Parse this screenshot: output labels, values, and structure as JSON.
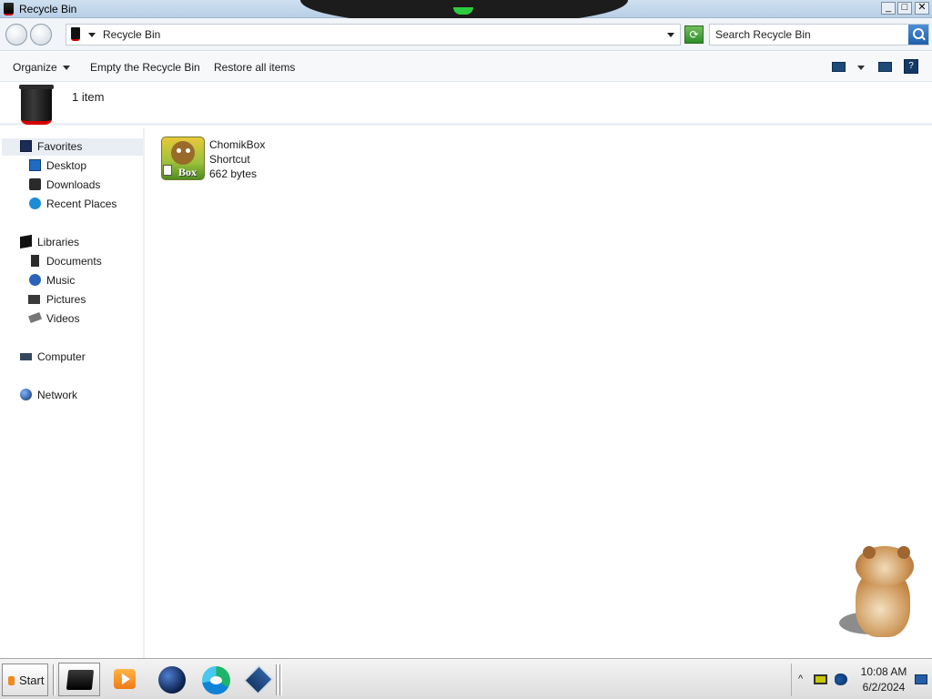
{
  "window": {
    "title": "Recycle Bin",
    "controls": {
      "minimize": "_",
      "maximize": "□",
      "close": "✕"
    }
  },
  "address": {
    "breadcrumb": "Recycle Bin",
    "search_placeholder": "Search Recycle Bin"
  },
  "toolbar": {
    "organize_label": "Organize",
    "empty_label": "Empty the Recycle Bin",
    "restore_label": "Restore all items",
    "help_label": "?"
  },
  "details": {
    "count": "1 item"
  },
  "sidebar": {
    "groups": [
      {
        "label": "Favorites",
        "icon": "star-icon",
        "items": [
          {
            "label": "Desktop",
            "icon": "desktop-icon"
          },
          {
            "label": "Downloads",
            "icon": "downloads-icon"
          },
          {
            "label": "Recent Places",
            "icon": "recent-places-icon"
          }
        ]
      },
      {
        "label": "Libraries",
        "icon": "libraries-icon",
        "items": [
          {
            "label": "Documents",
            "icon": "documents-icon"
          },
          {
            "label": "Music",
            "icon": "music-icon"
          },
          {
            "label": "Pictures",
            "icon": "pictures-icon"
          },
          {
            "label": "Videos",
            "icon": "videos-icon"
          }
        ]
      },
      {
        "label": "Computer",
        "icon": "computer-icon",
        "items": []
      },
      {
        "label": "Network",
        "icon": "network-icon",
        "items": []
      }
    ]
  },
  "files": [
    {
      "name": "ChomikBox",
      "type": "Shortcut",
      "size": "662 bytes",
      "icon_text": "Box",
      "icon": "chomikbox-icon"
    }
  ],
  "taskbar": {
    "start_label": "Start",
    "pinned": [
      "explorer-icon",
      "media-player-icon",
      "browser-globe-icon",
      "edge-icon",
      "virtualbox-icon"
    ],
    "tray_chevron": "^",
    "time": "10:08 AM",
    "date": "6/2/2024"
  },
  "colors": {
    "accent_red": "#d60000",
    "selection": "#e9eef4",
    "taskbar": "#e6e6e6"
  }
}
